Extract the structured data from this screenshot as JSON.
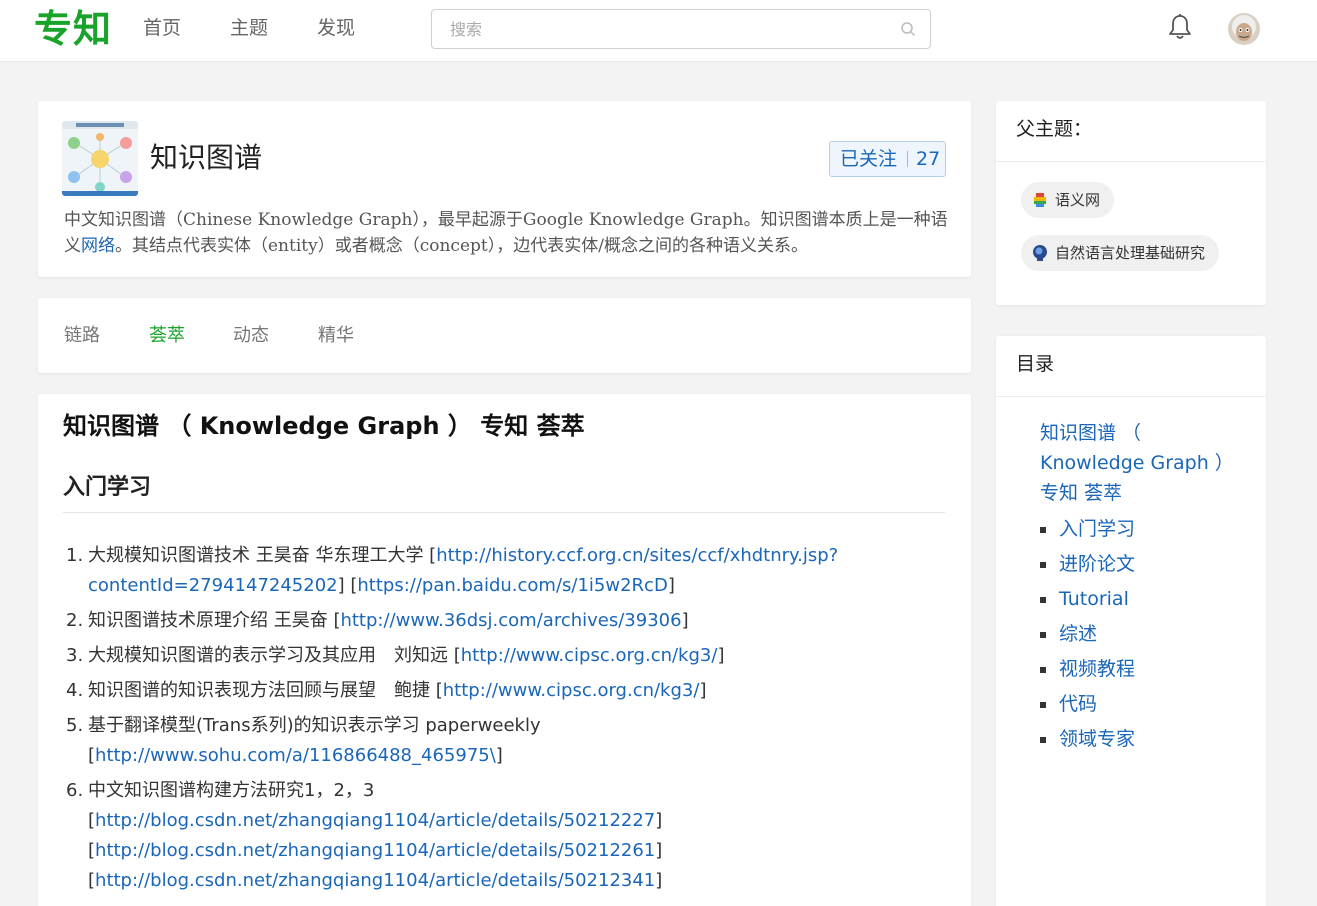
{
  "header": {
    "logo": "专知",
    "nav": [
      "首页",
      "主题",
      "发现"
    ],
    "search_placeholder": "搜索",
    "search_value": ""
  },
  "topic": {
    "title": "知识图谱",
    "follow_label": "已关注",
    "follow_count": "27",
    "desc_before": "中文知识图谱（Chinese Knowledge Graph），最早起源于Google Knowledge Graph。知识图谱本质上是一种语义",
    "desc_link": "网络",
    "desc_after": "。其结点代表实体（entity）或者概念（concept），边代表实体/概念之间的各种语义关系。"
  },
  "tabs": [
    {
      "label": "链路",
      "active": false
    },
    {
      "label": "荟萃",
      "active": true
    },
    {
      "label": "动态",
      "active": false
    },
    {
      "label": "精华",
      "active": false
    }
  ],
  "content": {
    "h1": "知识图谱 （ Knowledge Graph ） 专知 荟萃",
    "h2": "入门学习",
    "items": [
      {
        "num": "1.",
        "text": "大规模知识图谱技术 王昊奋 华东理工大学 [",
        "links": [
          "http://history.ccf.org.cn/sites/ccf/xhdtnry.jsp?contentId=2794147245202",
          "https://pan.baidu.com/s/1i5w2RcD"
        ]
      },
      {
        "num": "2.",
        "text": "知识图谱技术原理介绍 王昊奋 [",
        "links": [
          "http://www.36dsj.com/archives/39306"
        ]
      },
      {
        "num": "3.",
        "text": "大规模知识图谱的表示学习及其应用　刘知远 [",
        "links": [
          "http://www.cipsc.org.cn/kg3/"
        ]
      },
      {
        "num": "4.",
        "text": "知识图谱的知识表现方法回顾与展望　鲍捷 [",
        "links": [
          "http://www.cipsc.org.cn/kg3/"
        ]
      },
      {
        "num": "5.",
        "text": "基于翻译模型(Trans系列)的知识表示学习 paperweekly",
        "links": [
          "http://www.sohu.com/a/116866488_465975\\"
        ]
      },
      {
        "num": "6.",
        "text": "中文知识图谱构建方法研究1，2，3",
        "links": [
          "http://blog.csdn.net/zhangqiang1104/article/details/50212227",
          "http://blog.csdn.net/zhangqiang1104/article/details/50212261",
          "http://blog.csdn.net/zhangqiang1104/article/details/50212341"
        ]
      }
    ]
  },
  "sidebar": {
    "parent_title": "父主题：",
    "parents": [
      "语义网",
      "自然语言处理基础研究"
    ],
    "toc_title": "目录",
    "toc_main": "知识图谱 （ Knowledge Graph ） 专知 荟萃",
    "toc_items": [
      "入门学习",
      "进阶论文",
      "Tutorial",
      "综述",
      "视频教程",
      "代码",
      "领域专家"
    ]
  },
  "colors": {
    "brand": "#1aa32b",
    "link": "#1a66b8"
  }
}
